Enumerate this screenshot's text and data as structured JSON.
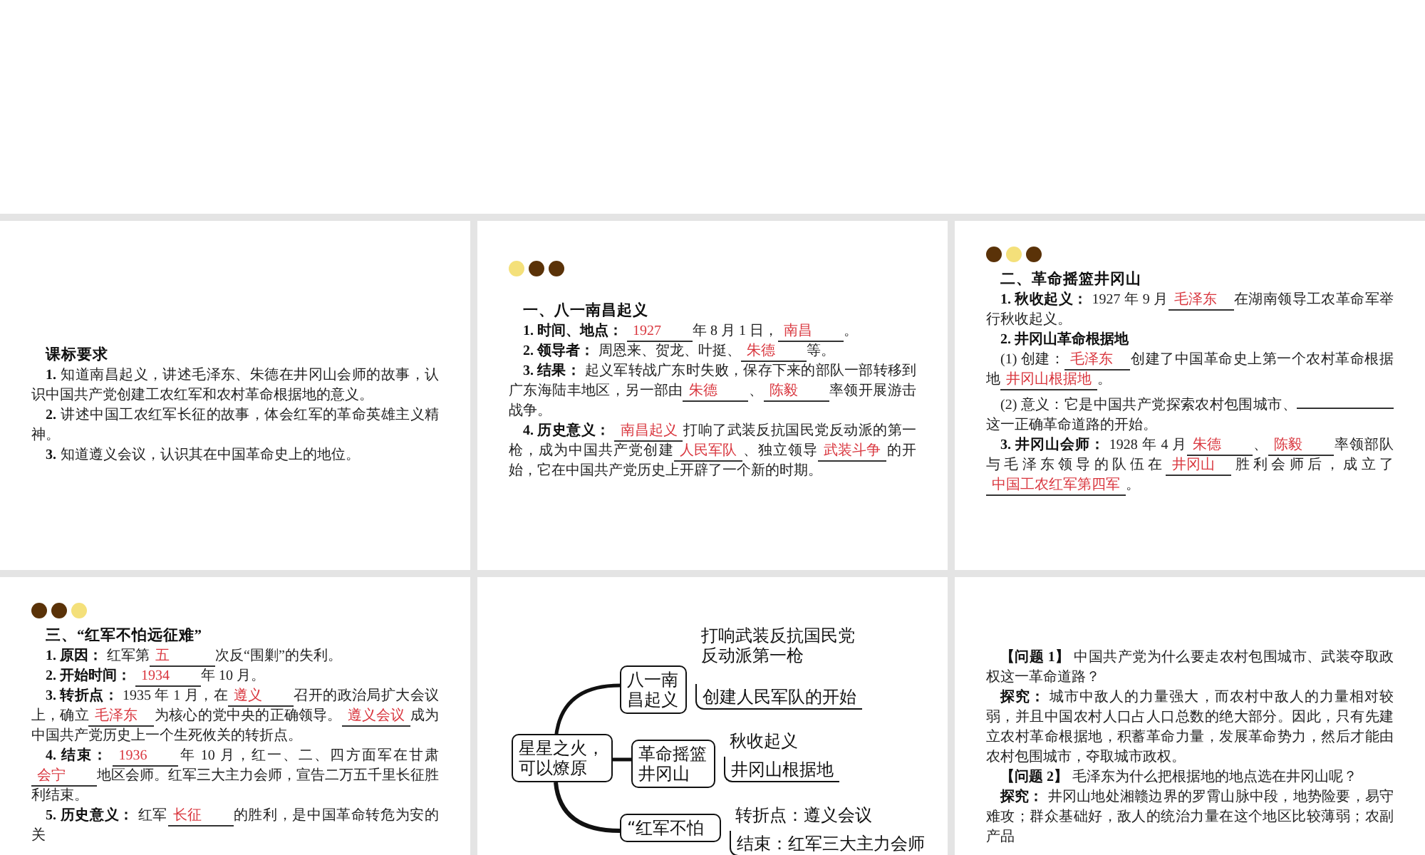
{
  "slides": [
    {
      "kind": "blank"
    },
    {
      "kind": "text",
      "title": "课标要求",
      "paragraphs": [
        {
          "label": "1.",
          "parts": [
            {
              "kind": "text",
              "text": "知道南昌起义，讲述毛泽东、朱德在井冈山会师的故事，认识中国共产党创建工农红军和农村革命根据地的意义。"
            }
          ]
        },
        {
          "label": "2.",
          "parts": [
            {
              "kind": "text",
              "text": "讲述中国工农红军长征的故事，体会红军的革命英雄主义精神。"
            }
          ]
        },
        {
          "label": "3.",
          "parts": [
            {
              "kind": "text",
              "text": "知道遵义会议，认识其在中国革命史上的地位。"
            }
          ]
        }
      ]
    },
    {
      "kind": "text",
      "dots": [
        {
          "selected": true
        },
        {
          "selected": false
        },
        {
          "selected": false
        }
      ],
      "title": "一、八一南昌起义",
      "paragraphs": [
        {
          "label": "1. 时间、地点：",
          "parts": [
            {
              "kind": "blank",
              "answer": "1927"
            },
            {
              "kind": "text",
              "text": "年 8 月 1 日，"
            },
            {
              "kind": "blank",
              "answer": "南昌"
            },
            {
              "kind": "text",
              "text": "。"
            }
          ]
        },
        {
          "label": "2. 领导者：",
          "parts": [
            {
              "kind": "text",
              "text": "周恩来、贺龙、叶挺、"
            },
            {
              "kind": "blank",
              "answer": "朱德"
            },
            {
              "kind": "text",
              "text": "等。"
            }
          ]
        },
        {
          "label": "3. 结果：",
          "parts": [
            {
              "kind": "text",
              "text": "起义军转战广东时失败，保存下来的部队一部转移到广东海陆丰地区，另一部由"
            },
            {
              "kind": "blank",
              "answer": "朱德"
            },
            {
              "kind": "text",
              "text": "、"
            },
            {
              "kind": "blank",
              "answer": "陈毅"
            },
            {
              "kind": "text",
              "text": "率领开展游击战争。"
            }
          ]
        },
        {
          "label": "4. 历史意义：",
          "parts": [
            {
              "kind": "blank",
              "answer": "南昌起义"
            },
            {
              "kind": "text",
              "text": "打响了武装反抗国民党反动派的第一枪，成为中国共产党创建"
            },
            {
              "kind": "blank",
              "answer": "人民军队"
            },
            {
              "kind": "text",
              "text": "、独立领导"
            },
            {
              "kind": "blank",
              "answer": "武装斗争"
            },
            {
              "kind": "text",
              "text": "的开始，它在中国共产党历史上开辟了一个新的时期。"
            }
          ]
        }
      ]
    },
    {
      "kind": "text",
      "dots": [
        {
          "selected": false
        },
        {
          "selected": true
        },
        {
          "selected": false
        }
      ],
      "title": "二、革命摇篮井冈山",
      "paragraphs": [
        {
          "label": "1. 秋收起义：",
          "parts": [
            {
              "kind": "text",
              "text": "1927 年 9 月"
            },
            {
              "kind": "blank",
              "answer": "毛泽东"
            },
            {
              "kind": "text",
              "text": "在湖南领导工农革命军举行秋收起义。"
            }
          ]
        },
        {
          "label": "2. 井冈山革命根据地"
        },
        {
          "parts": [
            {
              "kind": "text",
              "text": "(1) 创建："
            },
            {
              "kind": "blank",
              "answer": "毛泽东"
            },
            {
              "kind": "text",
              "text": "创建了中国革命史上第一个农村革命根据地"
            },
            {
              "kind": "blank",
              "answer": "井冈山根据地"
            },
            {
              "kind": "text",
              "text": "。"
            }
          ]
        },
        {
          "parts": [
            {
              "kind": "text",
              "text": "(2) 意义：它是中国共产党探索农村包围城市、"
            },
            {
              "kind": "blank"
            },
            {
              "kind": "text",
              "text": "这一正确革命道路的开始。"
            }
          ]
        },
        {
          "label": "3. 井冈山会师：",
          "parts": [
            {
              "kind": "text",
              "text": "1928 年 4 月"
            },
            {
              "kind": "blank",
              "answer": "朱德"
            },
            {
              "kind": "text",
              "text": "、"
            },
            {
              "kind": "blank",
              "answer": "陈毅"
            },
            {
              "kind": "text",
              "text": "率领部队与毛泽东领导的队伍在"
            },
            {
              "kind": "blank",
              "answer": "井冈山"
            },
            {
              "kind": "text",
              "text": "胜利会师后，成立了"
            },
            {
              "kind": "blank",
              "answer": "中国工农红军第四军"
            },
            {
              "kind": "text",
              "text": "。"
            }
          ]
        }
      ]
    },
    {
      "kind": "text",
      "dots": [
        {
          "selected": false
        },
        {
          "selected": false
        },
        {
          "selected": true
        }
      ],
      "title": "三、“红军不怕远征难”",
      "paragraphs": [
        {
          "label": "1. 原因：",
          "parts": [
            {
              "kind": "text",
              "text": "红军第"
            },
            {
              "kind": "blank",
              "answer": "五"
            },
            {
              "kind": "text",
              "text": "次反“围剿”的失利。"
            }
          ]
        },
        {
          "label": "2. 开始时间：",
          "parts": [
            {
              "kind": "blank",
              "answer": "1934"
            },
            {
              "kind": "text",
              "text": "年 10 月。"
            }
          ]
        },
        {
          "label": "3. 转折点：",
          "parts": [
            {
              "kind": "text",
              "text": "1935 年 1 月，在"
            },
            {
              "kind": "blank",
              "answer": "遵义"
            },
            {
              "kind": "text",
              "text": "召开的政治局扩大会议上，确立"
            },
            {
              "kind": "blank",
              "answer": "毛泽东"
            },
            {
              "kind": "text",
              "text": "为核心的党中央的正确领导。"
            },
            {
              "kind": "blank",
              "answer": "遵义会议"
            },
            {
              "kind": "text",
              "text": "成为中国共产党历史上一个生死攸关的转折点。"
            }
          ]
        },
        {
          "label": "4. 结束：",
          "parts": [
            {
              "kind": "blank",
              "answer": "1936"
            },
            {
              "kind": "text",
              "text": "年 10 月，红一、二、四方面军在甘肃"
            },
            {
              "kind": "blank",
              "answer": "会宁"
            },
            {
              "kind": "text",
              "text": "地区会师。红军三大主力会师，宣告二万五千里长征胜利结束。"
            }
          ]
        },
        {
          "label": "5. 历史意义：",
          "parts": [
            {
              "kind": "text",
              "text": "红军"
            },
            {
              "kind": "blank",
              "answer": "长征"
            },
            {
              "kind": "text",
              "text": "的胜利，是中国革命转危为安的关"
            }
          ]
        }
      ]
    },
    {
      "kind": "mindmap",
      "center": "星星之火，可以燎原",
      "branches": [
        {
          "label": "八一南昌起义",
          "leaves": [
            "打响武装反抗国民党反动派第一枪",
            "创建人民军队的开始"
          ]
        },
        {
          "label": "革命摇篮井冈山",
          "leaves": [
            "秋收起义",
            "井冈山根据地"
          ]
        },
        {
          "label": "“红军不怕",
          "leaves": [
            "转折点：遵义会议",
            "结束：红军三大主力会师"
          ]
        }
      ]
    },
    {
      "kind": "text",
      "paragraphs": [
        {
          "label": "【问题 1】",
          "parts": [
            {
              "kind": "text",
              "text": "中国共产党为什么要走农村包围城市、武装夺取政权这一革命道路？"
            }
          ]
        },
        {
          "label": "探究：",
          "parts": [
            {
              "kind": "text",
              "text": "城市中敌人的力量强大，而农村中敌人的力量相对较弱，并且中国农村人口占人口总数的绝大部分。因此，只有先建立农村革命根据地，积蓄革命力量，发展革命势力，然后才能由农村包围城市，夺取城市政权。"
            }
          ]
        },
        {
          "label": "【问题 2】",
          "parts": [
            {
              "kind": "text",
              "text": "毛泽东为什么把根据地的地点选在井冈山呢？"
            }
          ]
        },
        {
          "label": "探究：",
          "parts": [
            {
              "kind": "text",
              "text": "井冈山地处湘赣边界的罗霄山脉中段，地势险要，易守难攻；群众基础好，敌人的统治力量在这个地区比较薄弱；农副产品"
            }
          ]
        }
      ]
    }
  ]
}
